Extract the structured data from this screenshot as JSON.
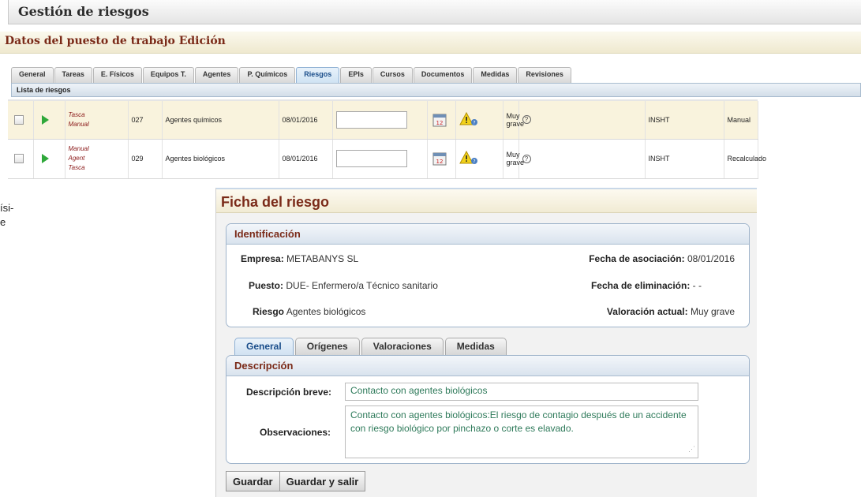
{
  "app": {
    "title": "Gestión de riesgos"
  },
  "subtitle": "Datos del puesto de trabajo  Edición",
  "tabs": [
    {
      "label": "General"
    },
    {
      "label": "Tareas"
    },
    {
      "label": "E. Físicos"
    },
    {
      "label": "Equipos T."
    },
    {
      "label": "Agentes"
    },
    {
      "label": "P. Químicos"
    },
    {
      "label": "Riesgos"
    },
    {
      "label": "EPIs"
    },
    {
      "label": "Cursos"
    },
    {
      "label": "Documentos"
    },
    {
      "label": "Medidas"
    },
    {
      "label": "Revisiones"
    }
  ],
  "active_tab": "Riesgos",
  "list_header": "Lista de riesgos",
  "risks": [
    {
      "origins": [
        "Tasca",
        "Manual"
      ],
      "code": "027",
      "name": "Agentes químicos",
      "date": "08/01/2016",
      "severity": "Muy grave",
      "source": "INSHT",
      "mode": "Manual"
    },
    {
      "origins": [
        "Manual",
        "Agent",
        "Tasca"
      ],
      "code": "029",
      "name": "Agentes biológicos",
      "date": "08/01/2016",
      "severity": "Muy grave",
      "source": "INSHT",
      "mode": "Recalculado"
    }
  ],
  "left_fragment": [
    "ísi-",
    "e"
  ],
  "ficha": {
    "title": "Ficha del riesgo",
    "identificacion": {
      "heading": "Identificación",
      "empresa_label": "Empresa:",
      "empresa": "METABANYS SL",
      "puesto_label": "Puesto:",
      "puesto": "DUE- Enfermero/a Técnico sanitario",
      "riesgo_label": "Riesgo",
      "riesgo": "Agentes biológicos",
      "fecha_asoc_label": "Fecha de asociación:",
      "fecha_asoc": "08/01/2016",
      "fecha_elim_label": "Fecha de eliminación:",
      "fecha_elim": "- -",
      "valoracion_label": "Valoración actual:",
      "valoracion": "Muy grave"
    },
    "sub_tabs": [
      {
        "label": "General"
      },
      {
        "label": "Orígenes"
      },
      {
        "label": "Valoraciones"
      },
      {
        "label": "Medidas"
      }
    ],
    "descripcion": {
      "heading": "Descripción",
      "breve_label": "Descripción breve:",
      "breve": "Contacto con agentes biológicos",
      "obs_label": "Observaciones:",
      "obs": "Contacto con agentes biológicos:El riesgo de contagio después de un accidente con riesgo biológico por pinchazo o corte es elavado."
    },
    "buttons": {
      "save": "Guardar",
      "save_exit": "Guardar y salir"
    }
  },
  "colors": {
    "accent_title": "#7a2a18",
    "play_icon": "#2fa83a",
    "input_text": "#2e7a5a"
  }
}
